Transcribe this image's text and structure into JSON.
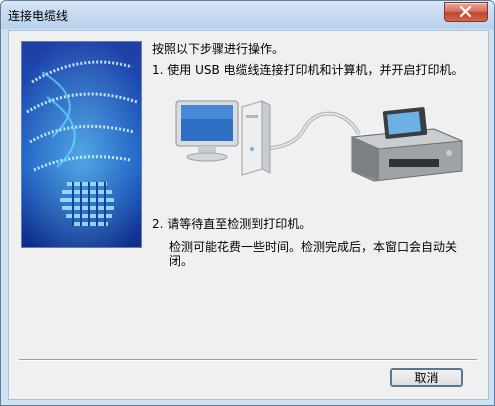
{
  "window": {
    "title": "连接电缆线"
  },
  "content": {
    "instruction_title": "按照以下步骤进行操作。",
    "step1": "1. 使用 USB 电缆线连接打印机和计算机，并开启打印机。",
    "step2": "2. 请等待直至检测到打印机。",
    "wait_note": "检测可能花费一些时间。检测完成后，本窗口会自动关闭。"
  },
  "buttons": {
    "cancel_label": "取消"
  },
  "icons": {
    "close": "close-icon",
    "computer": "computer-icon",
    "printer": "printer-icon",
    "usb_cable": "usb-cable-icon"
  },
  "colors": {
    "title_bar": "#c6daf0",
    "close_button": "#c0442b",
    "side_panel_blue": "#1b3fa0",
    "dialog_bg": "#f0f0f0"
  }
}
